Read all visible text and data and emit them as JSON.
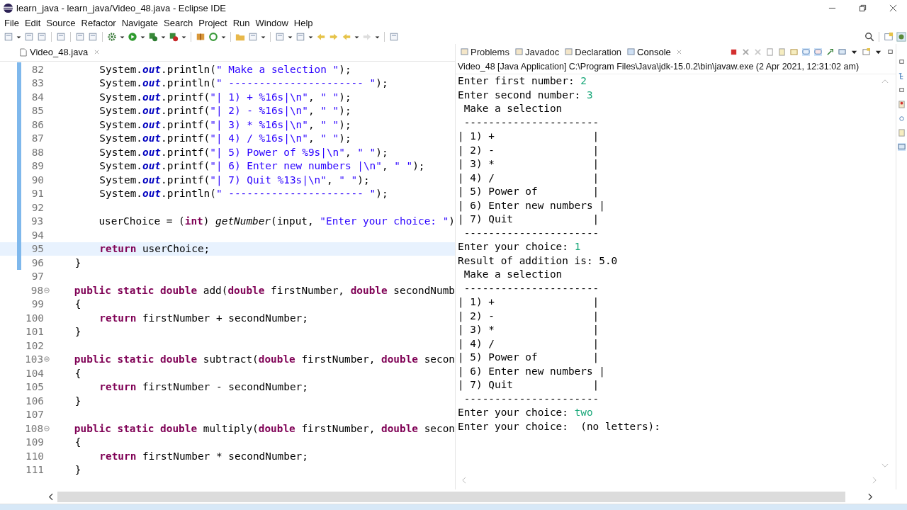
{
  "window": {
    "title": "learn_java - learn_java/Video_48.java - Eclipse IDE"
  },
  "menu": [
    "File",
    "Edit",
    "Source",
    "Refactor",
    "Navigate",
    "Search",
    "Project",
    "Run",
    "Window",
    "Help"
  ],
  "editor_tabs": [
    {
      "label": "Video_48.java",
      "selected": true
    }
  ],
  "code_lines": [
    {
      "number": "82",
      "changed": true,
      "current": false,
      "foldable": false,
      "tokens": [
        {
          "kind": "plain",
          "text": "        System."
        },
        {
          "kind": "field",
          "text": "out"
        },
        {
          "kind": "plain",
          "text": ".println("
        },
        {
          "kind": "string",
          "text": "\" Make a selection \""
        },
        {
          "kind": "plain",
          "text": ");"
        }
      ]
    },
    {
      "number": "83",
      "changed": true,
      "current": false,
      "foldable": false,
      "tokens": [
        {
          "kind": "plain",
          "text": "        System."
        },
        {
          "kind": "field",
          "text": "out"
        },
        {
          "kind": "plain",
          "text": ".println("
        },
        {
          "kind": "string",
          "text": "\" ---------------------- \""
        },
        {
          "kind": "plain",
          "text": ");"
        }
      ]
    },
    {
      "number": "84",
      "changed": true,
      "current": false,
      "foldable": false,
      "tokens": [
        {
          "kind": "plain",
          "text": "        System."
        },
        {
          "kind": "field",
          "text": "out"
        },
        {
          "kind": "plain",
          "text": ".printf("
        },
        {
          "kind": "string",
          "text": "\"| 1) + %16s|\\n\""
        },
        {
          "kind": "plain",
          "text": ", "
        },
        {
          "kind": "string",
          "text": "\" \""
        },
        {
          "kind": "plain",
          "text": ");"
        }
      ]
    },
    {
      "number": "85",
      "changed": true,
      "current": false,
      "foldable": false,
      "tokens": [
        {
          "kind": "plain",
          "text": "        System."
        },
        {
          "kind": "field",
          "text": "out"
        },
        {
          "kind": "plain",
          "text": ".printf("
        },
        {
          "kind": "string",
          "text": "\"| 2) - %16s|\\n\""
        },
        {
          "kind": "plain",
          "text": ", "
        },
        {
          "kind": "string",
          "text": "\" \""
        },
        {
          "kind": "plain",
          "text": ");"
        }
      ]
    },
    {
      "number": "86",
      "changed": true,
      "current": false,
      "foldable": false,
      "tokens": [
        {
          "kind": "plain",
          "text": "        System."
        },
        {
          "kind": "field",
          "text": "out"
        },
        {
          "kind": "plain",
          "text": ".printf("
        },
        {
          "kind": "string",
          "text": "\"| 3) * %16s|\\n\""
        },
        {
          "kind": "plain",
          "text": ", "
        },
        {
          "kind": "string",
          "text": "\" \""
        },
        {
          "kind": "plain",
          "text": ");"
        }
      ]
    },
    {
      "number": "87",
      "changed": true,
      "current": false,
      "foldable": false,
      "tokens": [
        {
          "kind": "plain",
          "text": "        System."
        },
        {
          "kind": "field",
          "text": "out"
        },
        {
          "kind": "plain",
          "text": ".printf("
        },
        {
          "kind": "string",
          "text": "\"| 4) / %16s|\\n\""
        },
        {
          "kind": "plain",
          "text": ", "
        },
        {
          "kind": "string",
          "text": "\" \""
        },
        {
          "kind": "plain",
          "text": ");"
        }
      ]
    },
    {
      "number": "88",
      "changed": true,
      "current": false,
      "foldable": false,
      "tokens": [
        {
          "kind": "plain",
          "text": "        System."
        },
        {
          "kind": "field",
          "text": "out"
        },
        {
          "kind": "plain",
          "text": ".printf("
        },
        {
          "kind": "string",
          "text": "\"| 5) Power of %9s|\\n\""
        },
        {
          "kind": "plain",
          "text": ", "
        },
        {
          "kind": "string",
          "text": "\" \""
        },
        {
          "kind": "plain",
          "text": ");"
        }
      ]
    },
    {
      "number": "89",
      "changed": true,
      "current": false,
      "foldable": false,
      "tokens": [
        {
          "kind": "plain",
          "text": "        System."
        },
        {
          "kind": "field",
          "text": "out"
        },
        {
          "kind": "plain",
          "text": ".printf("
        },
        {
          "kind": "string",
          "text": "\"| 6) Enter new numbers |\\n\""
        },
        {
          "kind": "plain",
          "text": ", "
        },
        {
          "kind": "string",
          "text": "\" \""
        },
        {
          "kind": "plain",
          "text": ");"
        }
      ]
    },
    {
      "number": "90",
      "changed": true,
      "current": false,
      "foldable": false,
      "tokens": [
        {
          "kind": "plain",
          "text": "        System."
        },
        {
          "kind": "field",
          "text": "out"
        },
        {
          "kind": "plain",
          "text": ".printf("
        },
        {
          "kind": "string",
          "text": "\"| 7) Quit %13s|\\n\""
        },
        {
          "kind": "plain",
          "text": ", "
        },
        {
          "kind": "string",
          "text": "\" \""
        },
        {
          "kind": "plain",
          "text": ");"
        }
      ]
    },
    {
      "number": "91",
      "changed": true,
      "current": false,
      "foldable": false,
      "tokens": [
        {
          "kind": "plain",
          "text": "        System."
        },
        {
          "kind": "field",
          "text": "out"
        },
        {
          "kind": "plain",
          "text": ".println("
        },
        {
          "kind": "string",
          "text": "\" ---------------------- \""
        },
        {
          "kind": "plain",
          "text": ");"
        }
      ]
    },
    {
      "number": "92",
      "changed": true,
      "current": false,
      "foldable": false
    },
    {
      "number": "93",
      "changed": true,
      "current": false,
      "foldable": false,
      "tokens": [
        {
          "kind": "plain",
          "text": "        userChoice = ("
        },
        {
          "kind": "keyword",
          "text": "int"
        },
        {
          "kind": "plain",
          "text": ") "
        },
        {
          "kind": "method",
          "text": "getNumber"
        },
        {
          "kind": "plain",
          "text": "(input, "
        },
        {
          "kind": "string",
          "text": "\"Enter your choice: \""
        },
        {
          "kind": "plain",
          "text": ")"
        }
      ]
    },
    {
      "number": "94",
      "changed": true,
      "current": false,
      "foldable": false
    },
    {
      "number": "95",
      "changed": true,
      "current": true,
      "foldable": false,
      "tokens": [
        {
          "kind": "keyword",
          "text": "        return"
        },
        {
          "kind": "plain",
          "text": " userChoice;"
        }
      ]
    },
    {
      "number": "96",
      "changed": true,
      "current": false,
      "foldable": false,
      "tokens": [
        {
          "kind": "plain",
          "text": "    }"
        }
      ]
    },
    {
      "number": "97",
      "changed": false,
      "current": false,
      "foldable": false
    },
    {
      "number": "98",
      "changed": false,
      "current": false,
      "foldable": true,
      "tokens": [
        {
          "kind": "keyword",
          "text": "    public static double"
        },
        {
          "kind": "plain",
          "text": " add("
        },
        {
          "kind": "keyword",
          "text": "double"
        },
        {
          "kind": "plain",
          "text": " firstNumber, "
        },
        {
          "kind": "keyword",
          "text": "double"
        },
        {
          "kind": "plain",
          "text": " secondNumb"
        }
      ]
    },
    {
      "number": "99",
      "changed": false,
      "current": false,
      "foldable": false,
      "tokens": [
        {
          "kind": "plain",
          "text": "    {"
        }
      ]
    },
    {
      "number": "100",
      "changed": false,
      "current": false,
      "foldable": false,
      "tokens": [
        {
          "kind": "keyword",
          "text": "        return"
        },
        {
          "kind": "plain",
          "text": " firstNumber + secondNumber;"
        }
      ]
    },
    {
      "number": "101",
      "changed": false,
      "current": false,
      "foldable": false,
      "tokens": [
        {
          "kind": "plain",
          "text": "    }"
        }
      ]
    },
    {
      "number": "102",
      "changed": false,
      "current": false,
      "foldable": false
    },
    {
      "number": "103",
      "changed": false,
      "current": false,
      "foldable": true,
      "tokens": [
        {
          "kind": "keyword",
          "text": "    public static double"
        },
        {
          "kind": "plain",
          "text": " subtract("
        },
        {
          "kind": "keyword",
          "text": "double"
        },
        {
          "kind": "plain",
          "text": " firstNumber, "
        },
        {
          "kind": "keyword",
          "text": "double"
        },
        {
          "kind": "plain",
          "text": " secon"
        }
      ]
    },
    {
      "number": "104",
      "changed": false,
      "current": false,
      "foldable": false,
      "tokens": [
        {
          "kind": "plain",
          "text": "    {"
        }
      ]
    },
    {
      "number": "105",
      "changed": false,
      "current": false,
      "foldable": false,
      "tokens": [
        {
          "kind": "keyword",
          "text": "        return"
        },
        {
          "kind": "plain",
          "text": " firstNumber - secondNumber;"
        }
      ]
    },
    {
      "number": "106",
      "changed": false,
      "current": false,
      "foldable": false,
      "tokens": [
        {
          "kind": "plain",
          "text": "    }"
        }
      ]
    },
    {
      "number": "107",
      "changed": false,
      "current": false,
      "foldable": false
    },
    {
      "number": "108",
      "changed": false,
      "current": false,
      "foldable": true,
      "tokens": [
        {
          "kind": "keyword",
          "text": "    public static double"
        },
        {
          "kind": "plain",
          "text": " multiply("
        },
        {
          "kind": "keyword",
          "text": "double"
        },
        {
          "kind": "plain",
          "text": " firstNumber, "
        },
        {
          "kind": "keyword",
          "text": "double"
        },
        {
          "kind": "plain",
          "text": " secon"
        }
      ]
    },
    {
      "number": "109",
      "changed": false,
      "current": false,
      "foldable": false,
      "tokens": [
        {
          "kind": "plain",
          "text": "    {"
        }
      ]
    },
    {
      "number": "110",
      "changed": false,
      "current": false,
      "foldable": false,
      "tokens": [
        {
          "kind": "keyword",
          "text": "        return"
        },
        {
          "kind": "plain",
          "text": " firstNumber * secondNumber;"
        }
      ]
    },
    {
      "number": "111",
      "changed": false,
      "current": false,
      "foldable": false,
      "tokens": [
        {
          "kind": "plain",
          "text": "    }"
        }
      ]
    }
  ],
  "view_tabs": [
    {
      "label": "Problems",
      "selected": false
    },
    {
      "label": "Javadoc",
      "selected": false
    },
    {
      "label": "Declaration",
      "selected": false
    },
    {
      "label": "Console",
      "selected": true
    }
  ],
  "console": {
    "header": "Video_48 [Java Application] C:\\Program Files\\Java\\jdk-15.0.2\\bin\\javaw.exe  (2 Apr 2021, 12:31:02 am)",
    "lines": [
      [
        {
          "kind": "output",
          "text": "Enter first number: "
        },
        {
          "kind": "input",
          "text": "2"
        }
      ],
      [
        {
          "kind": "output",
          "text": "Enter second number: "
        },
        {
          "kind": "input",
          "text": "3"
        }
      ],
      [
        {
          "kind": "output",
          "text": " Make a selection"
        }
      ],
      [
        {
          "kind": "output",
          "text": " ----------------------"
        }
      ],
      [
        {
          "kind": "output",
          "text": "| 1) +                |"
        }
      ],
      [
        {
          "kind": "output",
          "text": "| 2) -                |"
        }
      ],
      [
        {
          "kind": "output",
          "text": "| 3) *                |"
        }
      ],
      [
        {
          "kind": "output",
          "text": "| 4) /                |"
        }
      ],
      [
        {
          "kind": "output",
          "text": "| 5) Power of         |"
        }
      ],
      [
        {
          "kind": "output",
          "text": "| 6) Enter new numbers |"
        }
      ],
      [
        {
          "kind": "output",
          "text": "| 7) Quit             |"
        }
      ],
      [
        {
          "kind": "output",
          "text": " ----------------------"
        }
      ],
      [
        {
          "kind": "output",
          "text": "Enter your choice: "
        },
        {
          "kind": "input",
          "text": "1"
        }
      ],
      [
        {
          "kind": "output",
          "text": "Result of addition is: 5.0"
        }
      ],
      [
        {
          "kind": "output",
          "text": " Make a selection"
        }
      ],
      [
        {
          "kind": "output",
          "text": " ----------------------"
        }
      ],
      [
        {
          "kind": "output",
          "text": "| 1) +                |"
        }
      ],
      [
        {
          "kind": "output",
          "text": "| 2) -                |"
        }
      ],
      [
        {
          "kind": "output",
          "text": "| 3) *                |"
        }
      ],
      [
        {
          "kind": "output",
          "text": "| 4) /                |"
        }
      ],
      [
        {
          "kind": "output",
          "text": "| 5) Power of         |"
        }
      ],
      [
        {
          "kind": "output",
          "text": "| 6) Enter new numbers |"
        }
      ],
      [
        {
          "kind": "output",
          "text": "| 7) Quit             |"
        }
      ],
      [
        {
          "kind": "output",
          "text": " ----------------------"
        }
      ],
      [
        {
          "kind": "output",
          "text": "Enter your choice: "
        },
        {
          "kind": "input",
          "text": "two"
        }
      ],
      [
        {
          "kind": "output",
          "text": "Enter your choice:  (no letters):"
        }
      ]
    ]
  }
}
